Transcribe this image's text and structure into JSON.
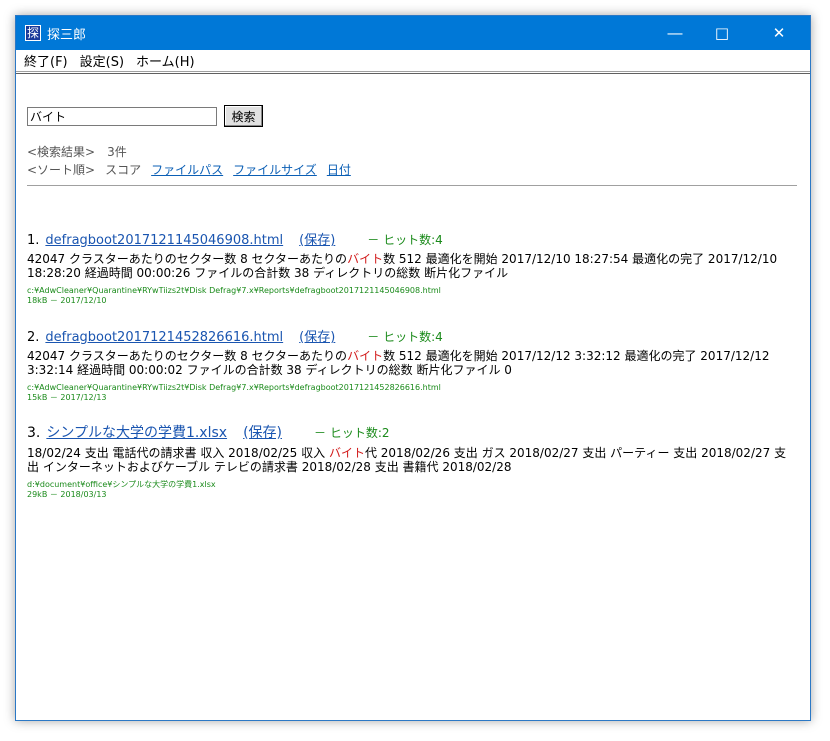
{
  "window": {
    "title": "探三郎",
    "icon_char": "探"
  },
  "menu": [
    "終了(F)",
    "設定(S)",
    "ホーム(H)"
  ],
  "search": {
    "value": "バイト",
    "button": "検索"
  },
  "summary": "<検索結果>　3件",
  "sort": {
    "label": "<ソート順>",
    "score": "スコア",
    "filepath": "ファイルパス",
    "filesize": "ファイルサイズ",
    "date": "日付"
  },
  "results": [
    {
      "num": "1.",
      "title": "defragboot20171211450469​08.html",
      "save": "(保存)",
      "hits": "－ ヒット数:4",
      "snippet_pre": "42047 クラスターあたりのセクター数 8 セクターあたりの",
      "snippet_hl": "バイト",
      "snippet_post": "数 512 最適化を開始 2017/12/10 18:27:54 最適化の完了 2017/12/10 18:28:20 経過時間 00:00:26 ファイルの合計数 38 ディレクトリの総数 断片化ファイル",
      "path": "c:¥AdwCleaner¥Quarantine¥RYwTiizs2t¥Disk Defrag¥7.x¥Reports¥defragboot20171211450469​08.html",
      "meta": "18kB － 2017/12/10"
    },
    {
      "num": "2.",
      "title": "defragboot20171214528266​16.html",
      "save": "(保存)",
      "hits": "－ ヒット数:4",
      "snippet_pre": "42047 クラスターあたりのセクター数 8 セクターあたりの",
      "snippet_hl": "バイト",
      "snippet_post": "数 512 最適化を開始 2017/12/12 3:32:12 最適化の完了 2017/12/12 3:32:14 経過時間 00:00:02 ファイルの合計数 38 ディレクトリの総数 断片化ファイル 0",
      "path": "c:¥AdwCleaner¥Quarantine¥RYwTiizs2t¥Disk Defrag¥7.x¥Reports¥defragboot20171214528266​16.html",
      "meta": "15kB － 2017/12/13"
    },
    {
      "num": "3.",
      "title": "シンプルな大学の学費1.xlsx",
      "save": "(保存)",
      "hits": "－ ヒット数:2",
      "snippet_pre": "18/02/24 支出 電話代の請求書 収入 2018/02/25 収入 ",
      "snippet_hl": "バイト",
      "snippet_post": "代 2018/02/26 支出 ガス 2018/02/27 支出 パーティー 支出 2018/02/27 支出 インターネットおよびケーブル テレビの請求書 2018/02/28 支出 書籍代 2018/02/28",
      "path": "d:¥document¥office¥シンプルな大学の学費1.xlsx",
      "meta": "29kB － 2018/03/13"
    }
  ]
}
